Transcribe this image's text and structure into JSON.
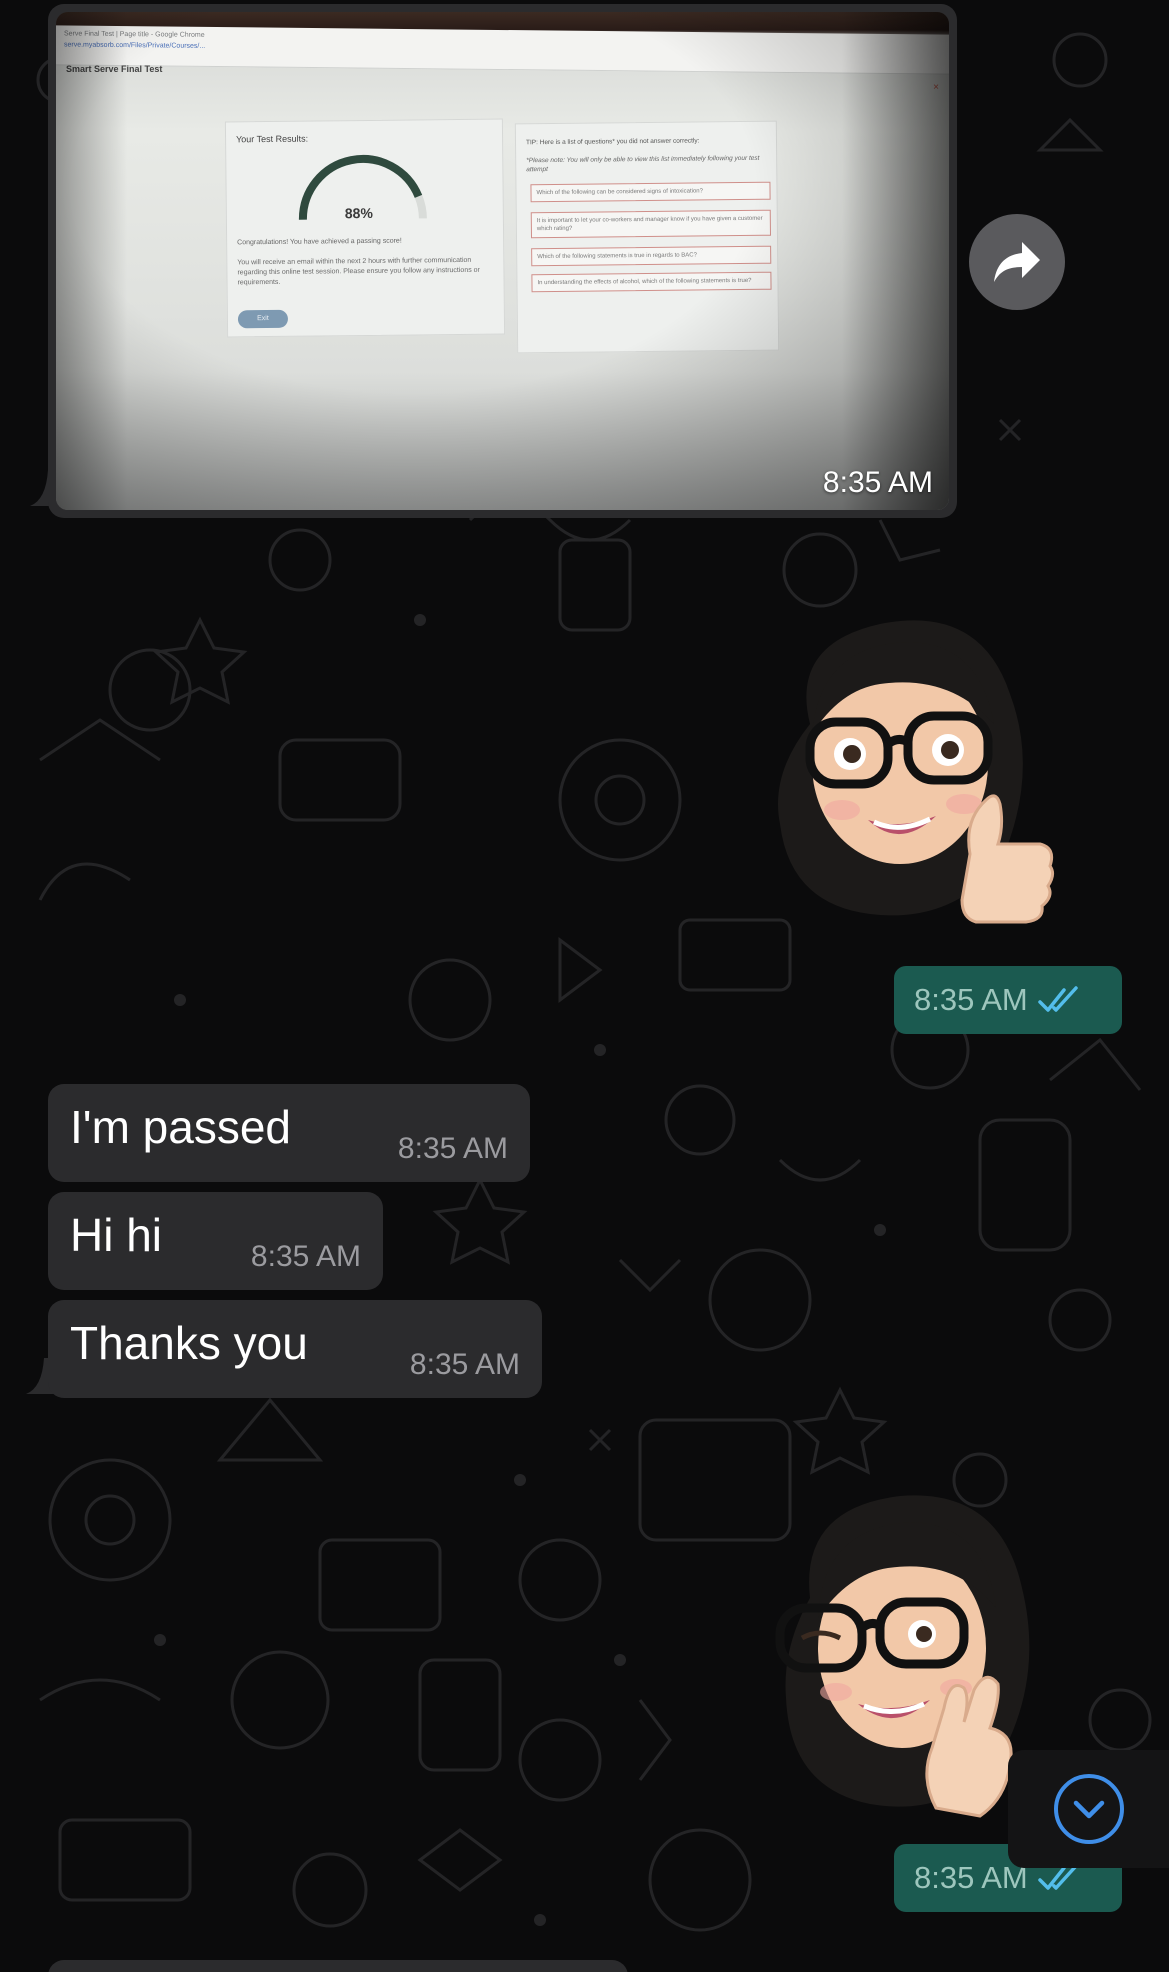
{
  "photo_message": {
    "time": "8:35 AM",
    "photo_content": {
      "browser_tab": "Serve Final Test | Page title - Google Chrome",
      "url": "serve.myabsorb.com/Files/Private/Courses/...",
      "site_title": "Smart Serve Final Test",
      "close_glyph": "×",
      "results_title": "Your Test Results:",
      "score_percent": "88%",
      "score_value": 0.88,
      "congrats": "Congratulations! You have achieved a passing score!",
      "email_note": "You will receive an email within the next 2 hours with further communication regarding this online test session. Please ensure you follow any instructions or requirements.",
      "exit_label": "Exit",
      "tip_head": "TIP: Here is a list of questions* you did not answer correctly:",
      "tip_note": "*Please note: You will only be able to view this list immediately following your test attempt",
      "questions": [
        "Which of the following can be considered signs of intoxication?",
        "It is important to let your co-workers and manager know if you have given a customer which rating?",
        "Which of the following statements is true in regards to BAC?",
        "In understanding the effects of alcohol, which of the following statements is true?"
      ]
    }
  },
  "sticker_1": {
    "time": "8:35 AM",
    "status": "read"
  },
  "incoming_messages": [
    {
      "text": "I'm passed",
      "time": "8:35 AM"
    },
    {
      "text": "Hi hi",
      "time": "8:35 AM"
    },
    {
      "text": "Thanks you",
      "time": "8:35 AM"
    }
  ],
  "sticker_2": {
    "time": "8:35 AM",
    "status": "read"
  },
  "colors": {
    "background": "#0b0b0c",
    "incoming_bubble": "#2b2b2d",
    "outgoing_pill": "#1b5a50",
    "read_ticks": "#53bdeb",
    "scroll_icon": "#3f8ee8"
  },
  "icons": {
    "forward": "forward-arrow-icon",
    "read_receipt": "double-check-icon",
    "scroll_down": "chevron-down-circle-icon"
  }
}
